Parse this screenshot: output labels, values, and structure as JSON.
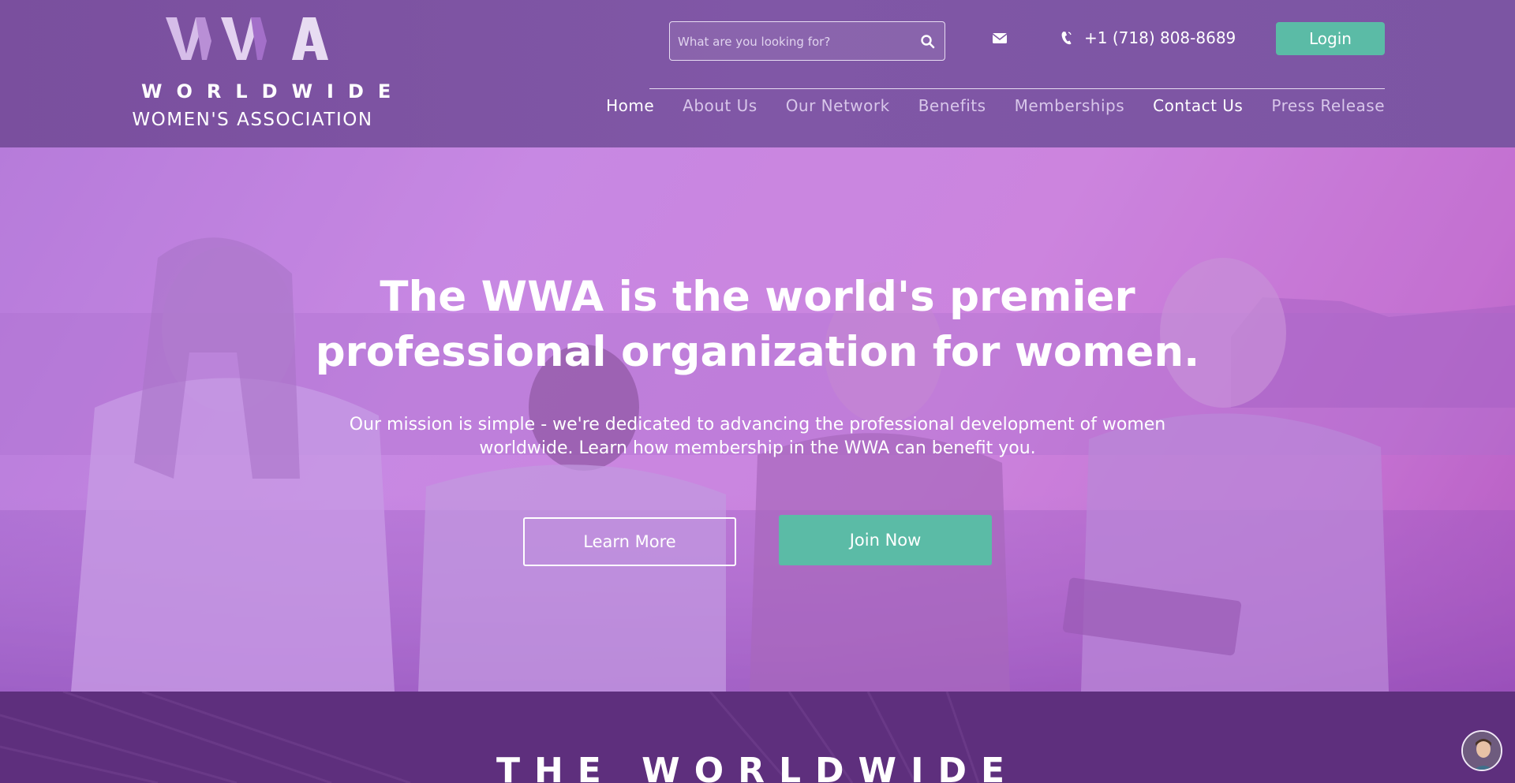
{
  "brand": {
    "mark": "WWA",
    "line1": "WORLDWIDE",
    "line2": "WOMEN'S ASSOCIATION"
  },
  "search": {
    "placeholder": "What are you looking for?",
    "icon": "search-icon"
  },
  "contact": {
    "mail_icon": "mail-icon",
    "phone_icon": "phone-icon",
    "phone": "+1 (718) 808-8689"
  },
  "login_label": "Login",
  "nav": {
    "items": [
      {
        "label": "Home"
      },
      {
        "label": "About Us"
      },
      {
        "label": "Our Network"
      },
      {
        "label": "Benefits"
      },
      {
        "label": "Memberships"
      },
      {
        "label": "Contact Us"
      },
      {
        "label": "Press Release"
      }
    ]
  },
  "hero": {
    "title_line1": "The WWA is the world's premier",
    "title_line2": "professional organization for women.",
    "subtitle_line1": "Our mission is simple - we're dedicated to advancing the professional development of women",
    "subtitle_line2": "worldwide. Learn how membership in the WWA can benefit you.",
    "learn_more_label": "Learn More",
    "join_now_label": "Join Now"
  },
  "section": {
    "heading": "THE WORLDWIDE"
  },
  "colors": {
    "header_bg": "#7c54a2",
    "accent_green": "#5bbba6",
    "hero_overlay": "#c98be4",
    "section_bg": "#5e2f7d"
  }
}
